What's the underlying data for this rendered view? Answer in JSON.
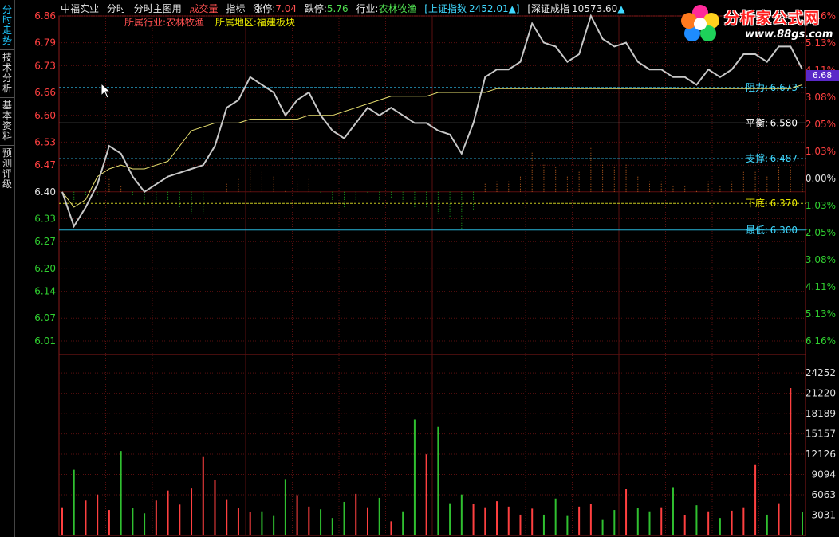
{
  "side_tabs": [
    "分时走势",
    "技术分析",
    "基本资料",
    "预测评级"
  ],
  "header": {
    "stock_name": "中福实业",
    "items": [
      "分时",
      "分时主图用"
    ],
    "vol_label": "成交量",
    "indicator_label": "指标",
    "limit_up_label": "涨停:",
    "limit_up_value": "7.04",
    "limit_down_label": "跌停:",
    "limit_down_value": "5.76",
    "industry_label": "行业:",
    "industry_value": "农林牧渔",
    "sh_index_label": "[上证指数",
    "sh_index_value": "2452.01",
    "sz_index_label": "[深证成指",
    "sz_index_value": "10573.60"
  },
  "subheader": {
    "industry_label": "所属行业",
    "industry_value": ":农林牧渔",
    "region_label": "所属地区",
    "region_value": ":福建板块"
  },
  "logo": {
    "name": "分析家公式网",
    "url": "www.88gs.com"
  },
  "current_price_tag": "6.68",
  "levels": {
    "resistance": {
      "label": "阻力:",
      "value": "6.673"
    },
    "balance": {
      "label": "平衡:",
      "value": "6.580"
    },
    "support": {
      "label": "支撑:",
      "value": "6.487"
    },
    "bottom": {
      "label": "下底:",
      "value": "6.370"
    },
    "low": {
      "label": "最低:",
      "value": "6.300"
    }
  },
  "chart_data": {
    "type": "line",
    "price_axis": {
      "ticks": [
        "6.86",
        "6.79",
        "6.73",
        "6.66",
        "6.60",
        "6.53",
        "6.47",
        "6.40",
        "6.33",
        "6.27",
        "6.20",
        "6.14",
        "6.07",
        "6.01"
      ],
      "ylim": [
        6.01,
        6.86
      ],
      "base": 6.4
    },
    "pct_axis": {
      "ticks": [
        "6.16%",
        "5.13%",
        "4.11%",
        "3.08%",
        "2.05%",
        "1.03%",
        "0.00%",
        "1.03%",
        "2.05%",
        "3.08%",
        "4.11%",
        "5.13%",
        "6.16%"
      ]
    },
    "volume_axis": {
      "ticks": [
        "24252",
        "21220",
        "18189",
        "15157",
        "12126",
        "9094",
        "6063",
        "3031"
      ],
      "ylim": [
        0,
        27000
      ]
    },
    "series": [
      {
        "values": [
          6.4,
          6.31,
          6.36,
          6.42,
          6.52,
          6.5,
          6.44,
          6.4,
          6.42,
          6.44,
          6.45,
          6.46,
          6.47,
          6.52,
          6.62,
          6.64,
          6.7,
          6.68,
          6.66,
          6.6,
          6.64,
          6.66,
          6.6,
          6.56,
          6.54,
          6.58,
          6.62,
          6.6,
          6.62,
          6.6,
          6.58,
          6.58,
          6.56,
          6.55,
          6.5,
          6.58,
          6.7,
          6.72,
          6.72,
          6.74,
          6.84,
          6.79,
          6.78,
          6.74,
          6.76,
          6.86,
          6.8,
          6.78,
          6.79,
          6.74,
          6.72,
          6.72,
          6.7,
          6.7,
          6.68,
          6.72,
          6.7,
          6.72,
          6.76,
          6.76,
          6.74,
          6.78,
          6.78,
          6.72
        ]
      },
      {
        "values": [
          6.4,
          6.36,
          6.38,
          6.44,
          6.46,
          6.47,
          6.46,
          6.46,
          6.47,
          6.48,
          6.52,
          6.56,
          6.57,
          6.58,
          6.58,
          6.58,
          6.59,
          6.59,
          6.59,
          6.59,
          6.59,
          6.6,
          6.6,
          6.6,
          6.61,
          6.62,
          6.63,
          6.64,
          6.65,
          6.65,
          6.65,
          6.65,
          6.66,
          6.66,
          6.66,
          6.66,
          6.66,
          6.67,
          6.67,
          6.67,
          6.67,
          6.67,
          6.67,
          6.67,
          6.67,
          6.67,
          6.67,
          6.67,
          6.67,
          6.67,
          6.67,
          6.67,
          6.67,
          6.67,
          6.67,
          6.67,
          6.67,
          6.67,
          6.67,
          6.67,
          6.67,
          6.67,
          6.67,
          6.68
        ]
      }
    ],
    "volume": [
      4200,
      9800,
      5200,
      6100,
      3800,
      12600,
      4100,
      3300,
      5200,
      6700,
      4600,
      7000,
      11800,
      8200,
      5400,
      4100,
      3500,
      3600,
      2900,
      8400,
      6000,
      4300,
      3900,
      2600,
      5000,
      6200,
      4200,
      5600,
      2100,
      3600,
      17300,
      12100,
      16200,
      4800,
      6100,
      4700,
      4200,
      5100,
      4300,
      3100,
      4000,
      3100,
      5500,
      2900,
      4300,
      4700,
      2300,
      3800,
      6900,
      4100,
      3600,
      4200,
      7200,
      3000,
      4500,
      3600,
      2600,
      3700,
      4200,
      10500,
      3100,
      4800,
      22000,
      3500
    ]
  }
}
